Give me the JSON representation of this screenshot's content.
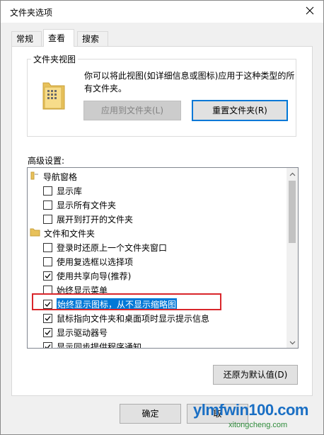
{
  "window": {
    "title": "文件夹选项"
  },
  "tabs": [
    {
      "label": "常规"
    },
    {
      "label": "查看"
    },
    {
      "label": "搜索"
    }
  ],
  "folder_view": {
    "legend": "文件夹视图",
    "description": "你可以将此视图(如详细信息或图标)应用于这种类型的所有文件夹。",
    "apply_button": "应用到文件夹(L)",
    "reset_button": "重置文件夹(R)"
  },
  "advanced": {
    "label": "高级设置:",
    "items": [
      {
        "type": "folder",
        "text": "导航窗格",
        "icon": "navigation-pane-icon"
      },
      {
        "type": "checkbox",
        "text": "显示库",
        "checked": false
      },
      {
        "type": "checkbox",
        "text": "显示所有文件夹",
        "checked": false
      },
      {
        "type": "checkbox",
        "text": "展开到打开的文件夹",
        "checked": false
      },
      {
        "type": "folder",
        "text": "文件和文件夹",
        "icon": "folder-icon"
      },
      {
        "type": "checkbox",
        "text": "登录时还原上一个文件夹窗口",
        "checked": false
      },
      {
        "type": "checkbox",
        "text": "使用复选框以选择项",
        "checked": false
      },
      {
        "type": "checkbox",
        "text": "使用共享向导(推荐)",
        "checked": true
      },
      {
        "type": "checkbox",
        "text": "始终显示菜单",
        "checked": false
      },
      {
        "type": "checkbox",
        "text": "始终显示图标，从不显示缩略图",
        "checked": true,
        "selected": true
      },
      {
        "type": "checkbox",
        "text": "鼠标指向文件夹和桌面项时显示提示信息",
        "checked": true
      },
      {
        "type": "checkbox",
        "text": "显示驱动器号",
        "checked": true
      },
      {
        "type": "checkbox",
        "text": "显示同步提供程序通知",
        "checked": true
      }
    ],
    "restore_defaults_button": "还原为默认值(D)"
  },
  "footer": {
    "ok_button": "确定",
    "cancel_button": "取"
  },
  "watermark": {
    "main": "ylmfwin100.com",
    "sub": "xitongcheng.com"
  },
  "colors": {
    "highlight_border": "#d9262b",
    "selection": "#0078d7",
    "focus_border": "#0078d7"
  }
}
